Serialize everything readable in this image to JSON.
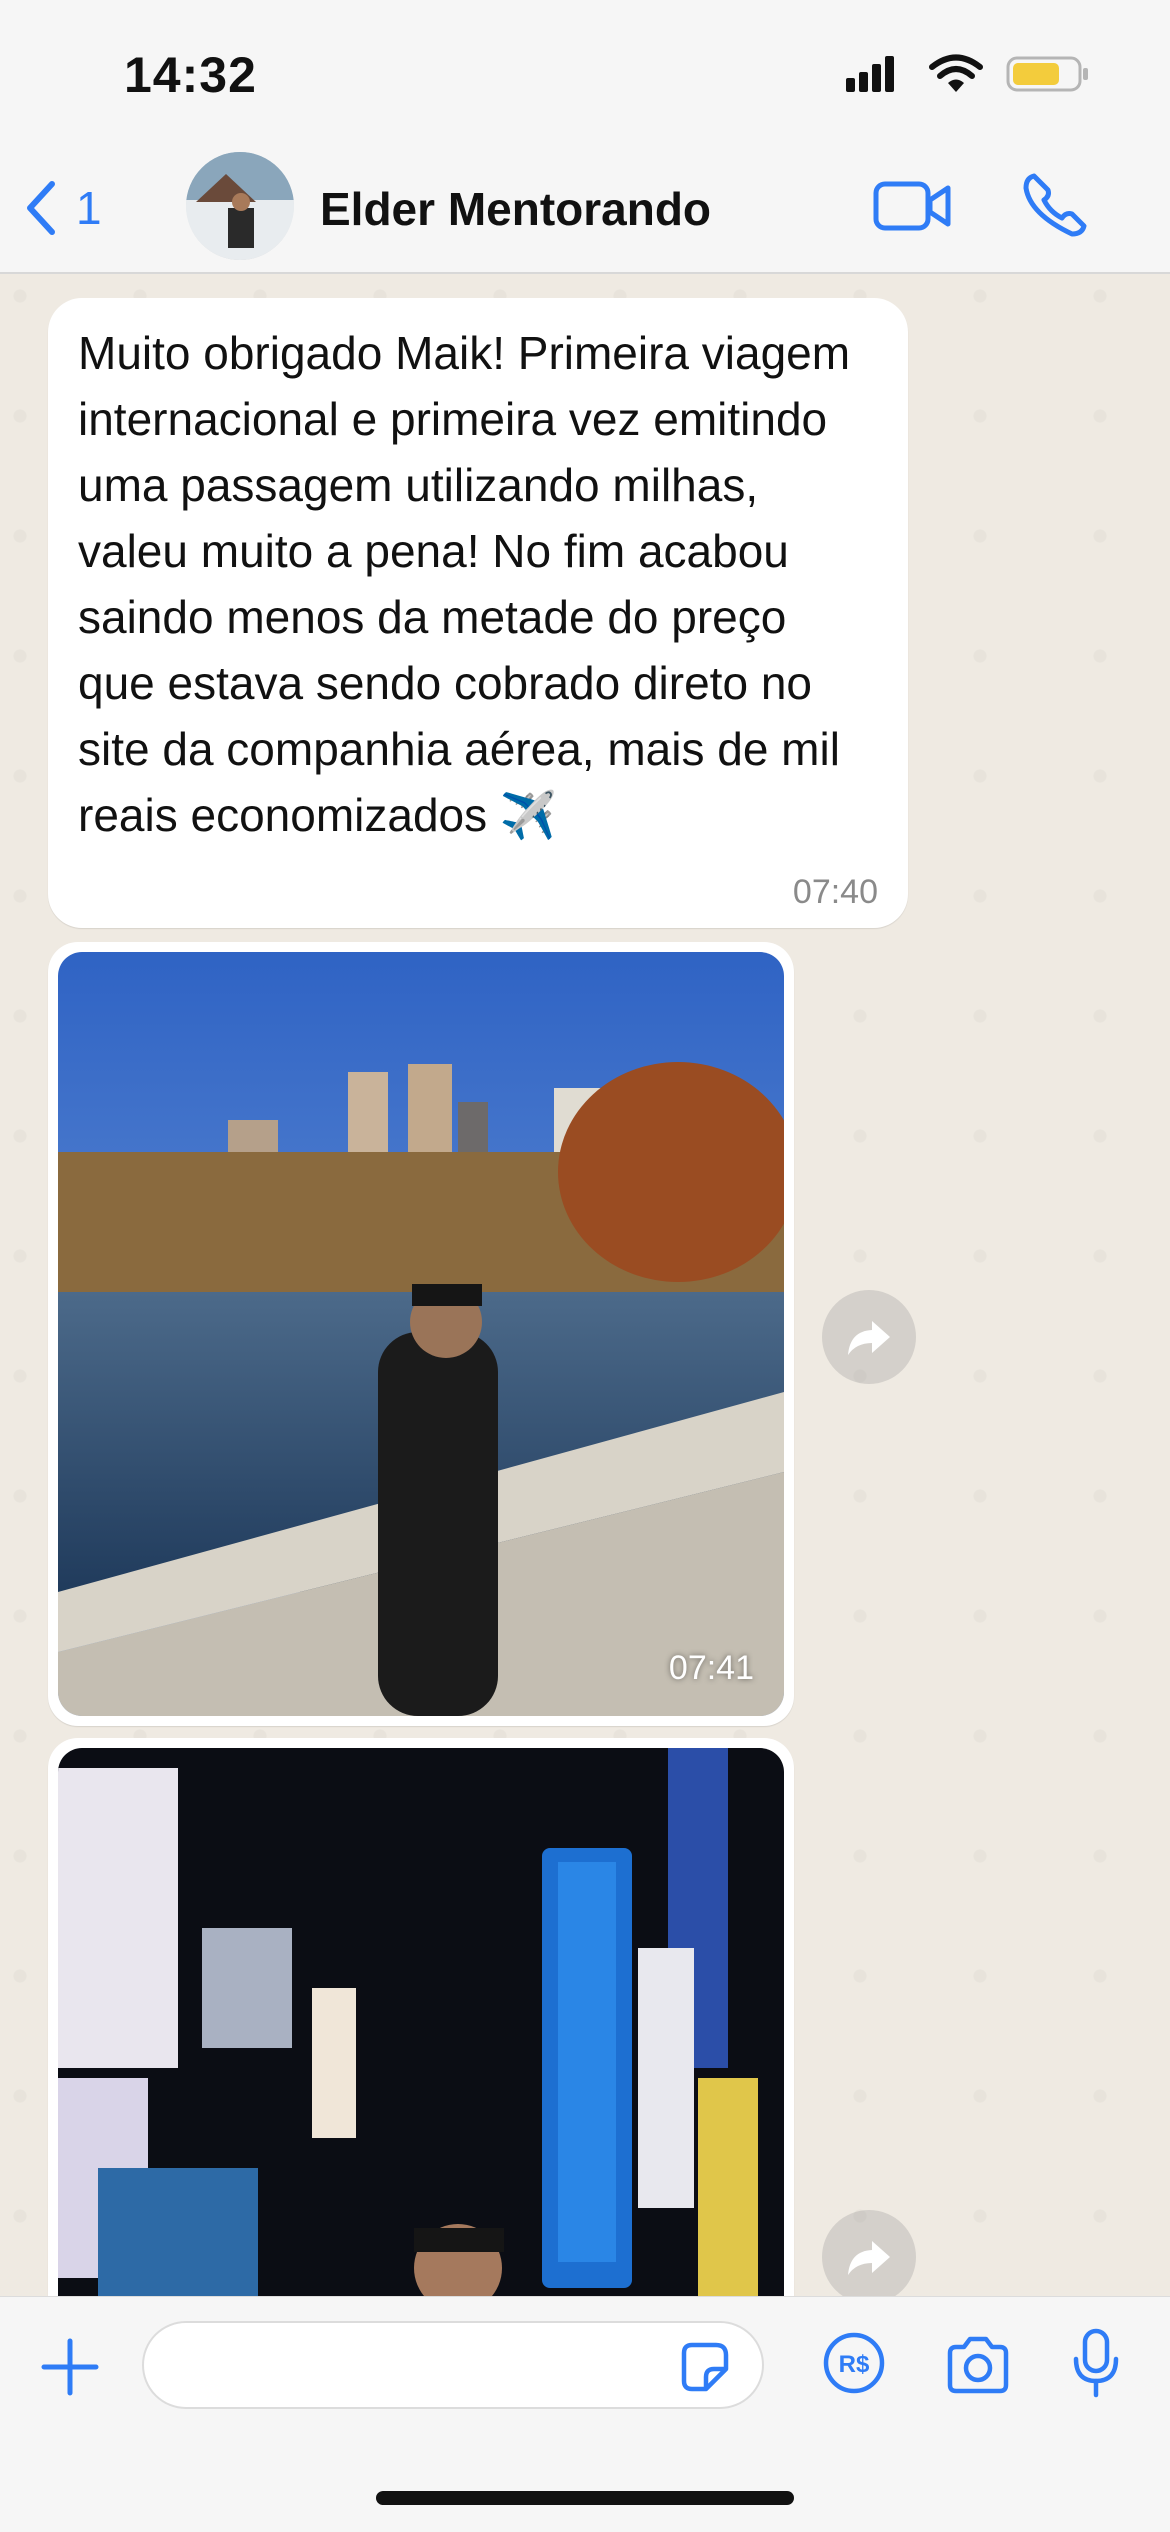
{
  "status_bar": {
    "time": "14:32"
  },
  "header": {
    "back_count": "1",
    "contact_name": "Elder Mentorando"
  },
  "messages": [
    {
      "text": "Muito obrigado Maik! Primeira viagem internacional e primeira vez emitindo uma passagem utilizando milhas, valeu muito a pena! No fim acabou saindo menos da metade do preço que estava sendo cobrado direto no site da companhia aérea, mais de mil reais economizados ✈️",
      "time": "07:40"
    },
    {
      "type": "image",
      "time": "07:41"
    },
    {
      "type": "image",
      "time": ""
    }
  ],
  "colors": {
    "accent": "#2f7cf6",
    "chat_bg": "#efeae2",
    "bubble": "#ffffff"
  }
}
